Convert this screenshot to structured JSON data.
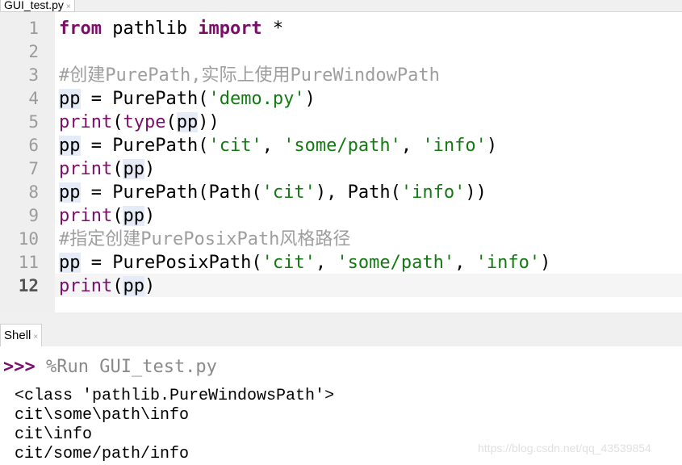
{
  "editor_tab": {
    "title": "GUI_test.py",
    "close": "×"
  },
  "editor": {
    "line_numbers": [
      "1",
      "2",
      "3",
      "4",
      "5",
      "6",
      "7",
      "8",
      "9",
      "10",
      "11",
      "12"
    ],
    "lines": [
      "from pathlib import *",
      "",
      "#创建PurePath,实际上使用PureWindowPath",
      "pp = PurePath('demo.py')",
      "print(type(pp))",
      "pp = PurePath('cit', 'some/path', 'info')",
      "print(pp)",
      "pp = PurePath(Path('cit'), Path('info'))",
      "print(pp)",
      "#指定创建PurePosixPath风格路径",
      "pp = PurePosixPath('cit', 'some/path', 'info')",
      "print(pp)"
    ],
    "current_line": 12
  },
  "shell_tab": {
    "title": "Shell",
    "close": "×"
  },
  "shell": {
    "prompt": ">>>",
    "command": "%Run GUI_test.py",
    "output": [
      "<class 'pathlib.PureWindowsPath'>",
      "cit\\some\\path\\info",
      "cit\\info",
      "cit/some/path/info"
    ]
  },
  "watermark": "https://blog.csdn.net/qq_43539854",
  "colors": {
    "keyword": "#7a0f6a",
    "string": "#137a13",
    "comment": "#9e9e9e",
    "gutter": "#efefef"
  }
}
